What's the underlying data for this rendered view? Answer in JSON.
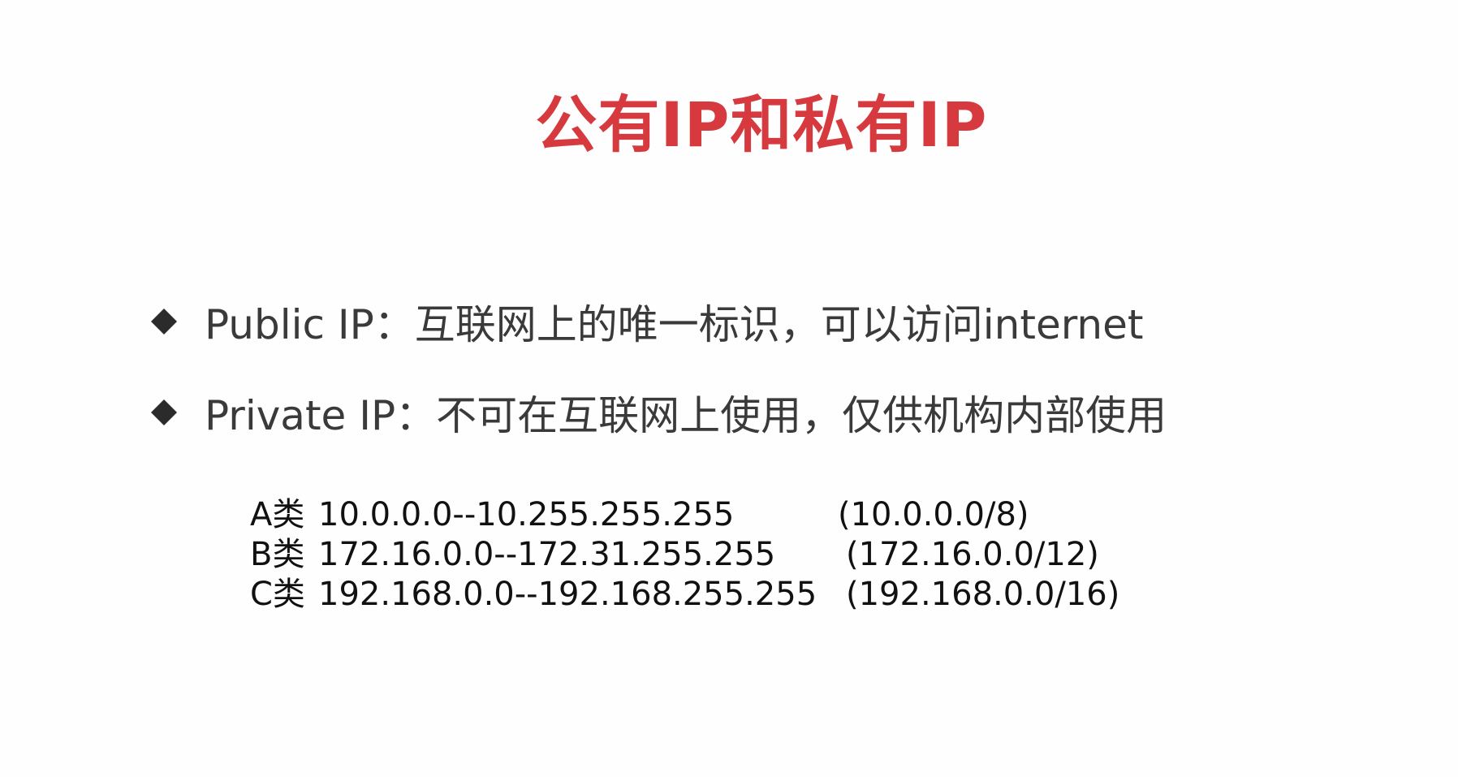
{
  "slide": {
    "title": "公有IP和私有IP",
    "bullets": [
      {
        "icon": "diamond-bullet-icon",
        "text": "Public IP：互联网上的唯一标识，可以访问internet"
      },
      {
        "icon": "diamond-bullet-icon",
        "text": "Private IP：不可在互联网上使用，仅供机构内部使用"
      }
    ],
    "ranges": [
      {
        "class": "A类",
        "span": "10.0.0.0--10.255.255.255",
        "cidr": "(10.0.0.0/8)"
      },
      {
        "class": "B类",
        "span": "172.16.0.0--172.31.255.255",
        "cidr": "(172.16.0.0/12)"
      },
      {
        "class": "C类",
        "span": "192.168.0.0--192.168.255.255",
        "cidr": "(192.168.0.0/16)"
      }
    ]
  },
  "colors": {
    "title": "#d63a3f",
    "bullet_text": "#3a3a3a",
    "range_text": "#111111",
    "background": "#fefefe"
  }
}
